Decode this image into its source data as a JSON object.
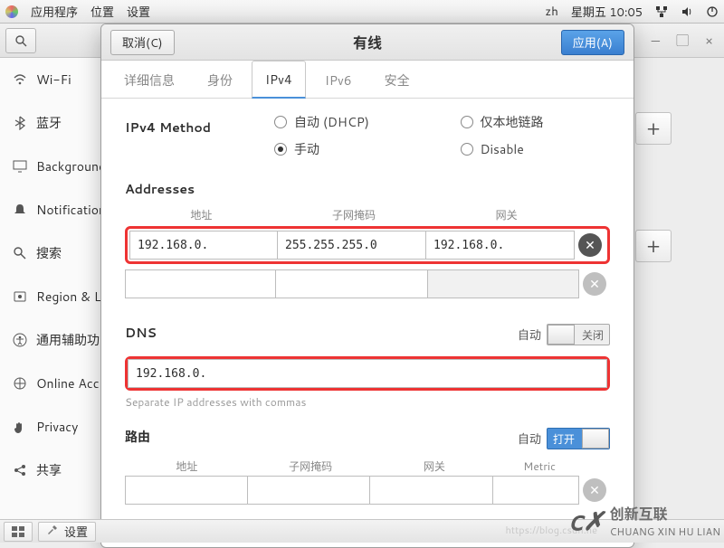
{
  "topbar": {
    "menus": [
      "应用程序",
      "位置",
      "设置"
    ],
    "lang": "zh",
    "clock": "星期五 10:05"
  },
  "winCtrl": {
    "min": "—",
    "max": "▢",
    "close": "×"
  },
  "sidebar": {
    "items": [
      {
        "icon": "wifi",
        "label": "Wi-Fi"
      },
      {
        "icon": "bt",
        "label": "蓝牙"
      },
      {
        "icon": "bg",
        "label": "Background"
      },
      {
        "icon": "bell",
        "label": "Notifications"
      },
      {
        "icon": "search",
        "label": "搜索"
      },
      {
        "icon": "region",
        "label": "Region & L"
      },
      {
        "icon": "a11y",
        "label": "通用辅助功"
      },
      {
        "icon": "online",
        "label": "Online Acc"
      },
      {
        "icon": "privacy",
        "label": "Privacy"
      },
      {
        "icon": "share",
        "label": "共享"
      }
    ]
  },
  "dialog": {
    "cancel": "取消(C)",
    "title": "有线",
    "apply": "应用(A)",
    "tabs": [
      "详细信息",
      "身份",
      "IPv4",
      "IPv6",
      "安全"
    ],
    "activeTab": 2,
    "ipv4": {
      "methodLabel": "IPv4 Method",
      "methods": {
        "dhcp": "自动 (DHCP)",
        "linklocal": "仅本地链路",
        "manual": "手动",
        "disable": "Disable"
      },
      "selected": "manual",
      "addresses": {
        "title": "Addresses",
        "cols": [
          "地址",
          "子网掩码",
          "网关"
        ],
        "rows": [
          {
            "addr": "192.168.0. ",
            "mask": "255.255.255.0",
            "gw": "192.168.0. "
          }
        ]
      },
      "dns": {
        "title": "DNS",
        "autoLabel": "自动",
        "state": "关闭",
        "value": "192.168.0. ",
        "hint": "Separate IP addresses with commas"
      },
      "routes": {
        "title": "路由",
        "autoLabel": "自动",
        "state": "打开",
        "cols": [
          "地址",
          "子网掩码",
          "网关",
          "Metric"
        ]
      }
    }
  },
  "bottombar": {
    "settings": "设置"
  },
  "watermark": {
    "brand": "创新互联",
    "sub": "CHUANG XIN HU LIAN",
    "url": "https://blog.csdn.ne"
  }
}
